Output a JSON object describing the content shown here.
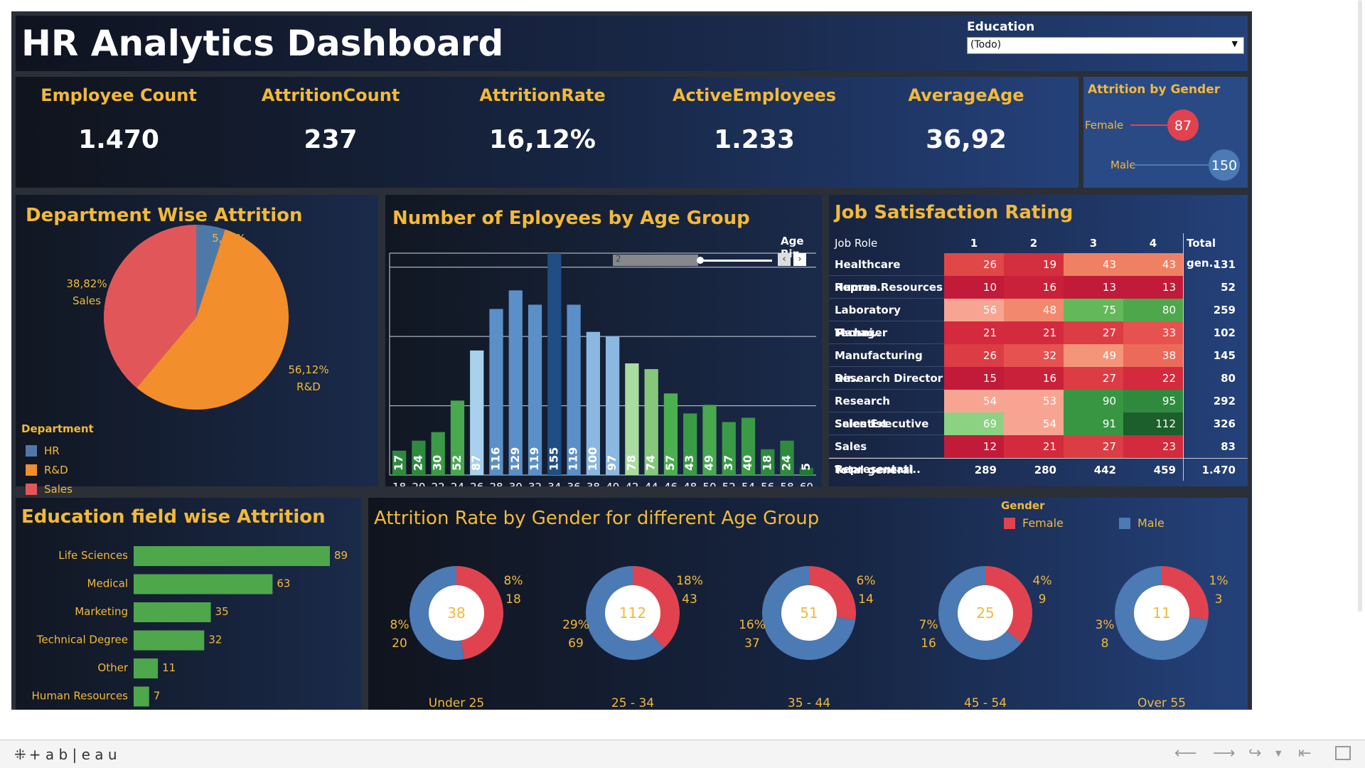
{
  "header": {
    "title": "HR Analytics Dashboard"
  },
  "filter": {
    "label": "Education",
    "value": "(Todo)"
  },
  "kpis": [
    {
      "label": "Employee Count",
      "value": "1.470"
    },
    {
      "label": "AttritionCount",
      "value": "237"
    },
    {
      "label": "AttritionRate",
      "value": "16,12%"
    },
    {
      "label": "ActiveEmployees",
      "value": "1.233"
    },
    {
      "label": "AverageAge",
      "value": "36,92"
    }
  ],
  "gender_attrition": {
    "title": "Attrition by Gender",
    "rows": [
      {
        "label": "Female",
        "value": 87,
        "color": "#e0434f"
      },
      {
        "label": "Male",
        "value": 150,
        "color": "#4b7ab5"
      }
    ]
  },
  "department": {
    "title": "Department Wise Attrition",
    "legend_title": "Department",
    "slices": [
      {
        "name": "HR",
        "pct": "5,06%",
        "value": 5.06,
        "color": "#4e79a7"
      },
      {
        "name": "R&D",
        "pct": "56,12%",
        "value": 56.12,
        "color": "#f28e2b"
      },
      {
        "name": "Sales",
        "pct": "38,82%",
        "value": 38.82,
        "color": "#e15759"
      }
    ]
  },
  "age_hist": {
    "title": "Number of Eployees by Age Group",
    "control_label": "Age Bin",
    "slider_value": "2",
    "bins": [
      18,
      20,
      22,
      24,
      26,
      28,
      30,
      32,
      34,
      36,
      38,
      40,
      42,
      44,
      46,
      48,
      50,
      52,
      54,
      56,
      58,
      60
    ],
    "values": [
      17,
      24,
      30,
      52,
      87,
      116,
      129,
      119,
      155,
      119,
      100,
      97,
      78,
      74,
      57,
      43,
      49,
      37,
      40,
      18,
      24,
      5
    ],
    "colors": [
      "#2e8b3e",
      "#2e8b3e",
      "#3a9a45",
      "#48a94f",
      "#a9d0ec",
      "#5b8fc7",
      "#5b8fc7",
      "#5b8fc7",
      "#1f4e85",
      "#5b8fc7",
      "#8ab8e0",
      "#8ab8e0",
      "#a9dca0",
      "#86c77c",
      "#4caf50",
      "#3a9a45",
      "#48a94f",
      "#3a9a45",
      "#3a9a45",
      "#2e8b3e",
      "#2e8b3e",
      "#1f7a34"
    ]
  },
  "chart_data": [
    {
      "type": "pie",
      "title": "Department Wise Attrition",
      "categories": [
        "HR",
        "R&D",
        "Sales"
      ],
      "values": [
        5.06,
        56.12,
        38.82
      ]
    },
    {
      "type": "bar",
      "title": "Number of Eployees by Age Group",
      "xlabel": "Age Bin",
      "categories": [
        18,
        20,
        22,
        24,
        26,
        28,
        30,
        32,
        34,
        36,
        38,
        40,
        42,
        44,
        46,
        48,
        50,
        52,
        54,
        56,
        58,
        60
      ],
      "values": [
        17,
        24,
        30,
        52,
        87,
        116,
        129,
        119,
        155,
        119,
        100,
        97,
        78,
        74,
        57,
        43,
        49,
        37,
        40,
        18,
        24,
        5
      ]
    },
    {
      "type": "bar",
      "title": "Education field wise Attrition",
      "categories": [
        "Life Sciences",
        "Medical",
        "Marketing",
        "Technical Degree",
        "Other",
        "Human Resources"
      ],
      "values": [
        89,
        63,
        35,
        32,
        11,
        7
      ]
    },
    {
      "type": "pie",
      "title": "Attrition Rate by Gender for different Age Group",
      "groups": [
        "Under 25",
        "25 - 34",
        "35 - 44",
        "45 - 54",
        "Over 55"
      ],
      "female": [
        18,
        43,
        14,
        9,
        3
      ],
      "male": [
        20,
        69,
        37,
        16,
        8
      ],
      "total": [
        38,
        112,
        51,
        25,
        11
      ]
    }
  ],
  "job_sat": {
    "title": "Job Satisfaction Rating",
    "headers": [
      "Job Role",
      "1",
      "2",
      "3",
      "4",
      "Total gen.."
    ],
    "rows": [
      {
        "role": "Healthcare Repres..",
        "vals": [
          26,
          19,
          43,
          43
        ],
        "total": "131",
        "colors": [
          "#e04848",
          "#d42f3e",
          "#f08063",
          "#f08063"
        ]
      },
      {
        "role": "Human Resources",
        "vals": [
          10,
          16,
          13,
          13
        ],
        "total": "52",
        "colors": [
          "#c21a39",
          "#c82139",
          "#c21a39",
          "#c21a39"
        ]
      },
      {
        "role": "Laboratory Techni..",
        "vals": [
          56,
          48,
          75,
          80
        ],
        "total": "259",
        "colors": [
          "#f7a592",
          "#f2896e",
          "#63b85a",
          "#4ea74b"
        ]
      },
      {
        "role": "Manager",
        "vals": [
          21,
          21,
          27,
          33
        ],
        "total": "102",
        "colors": [
          "#d32a3d",
          "#d32a3d",
          "#dc3c44",
          "#e6524f"
        ]
      },
      {
        "role": "Manufacturing Dir..",
        "vals": [
          26,
          32,
          49,
          38
        ],
        "total": "145",
        "colors": [
          "#dc3c44",
          "#e6524f",
          "#f4957a",
          "#ec6a5a"
        ]
      },
      {
        "role": "Research Director",
        "vals": [
          15,
          16,
          27,
          22
        ],
        "total": "80",
        "colors": [
          "#c21a39",
          "#c82139",
          "#dc3c44",
          "#d32a3d"
        ]
      },
      {
        "role": "Research Scientist",
        "vals": [
          54,
          53,
          90,
          95
        ],
        "total": "292",
        "colors": [
          "#f7a592",
          "#f7a592",
          "#389643",
          "#2f8a3d"
        ]
      },
      {
        "role": "Sales Executive",
        "vals": [
          69,
          54,
          91,
          112
        ],
        "total": "326",
        "colors": [
          "#8bd283",
          "#f7a592",
          "#389643",
          "#1c5e2c"
        ]
      },
      {
        "role": "Sales Representati..",
        "vals": [
          12,
          21,
          27,
          23
        ],
        "total": "83",
        "colors": [
          "#c21a39",
          "#d32a3d",
          "#dc3c44",
          "#d32a3d"
        ]
      }
    ],
    "totals": {
      "label": "Total general",
      "vals": [
        "289",
        "280",
        "442",
        "459"
      ],
      "total": "1.470"
    }
  },
  "education": {
    "title": "Education field wise Attrition",
    "items": [
      {
        "label": "Life Sciences",
        "value": 89
      },
      {
        "label": "Medical",
        "value": 63
      },
      {
        "label": "Marketing",
        "value": 35
      },
      {
        "label": "Technical Degree",
        "value": 32
      },
      {
        "label": "Other",
        "value": 11
      },
      {
        "label": "Human Resources",
        "value": 7
      }
    ],
    "bar_color": "#4ea74b"
  },
  "gender_age": {
    "title": "Attrition Rate by Gender for different Age Group",
    "legend_title": "Gender",
    "legend": [
      {
        "label": "Female",
        "color": "#e0434f"
      },
      {
        "label": "Male",
        "color": "#4b7ab5"
      }
    ],
    "groups": [
      {
        "label": "Under 25",
        "total": "38",
        "female": 18,
        "male": 20,
        "f_pct": "8%",
        "f_val": "18",
        "m_pct": "8%",
        "m_val": "20"
      },
      {
        "label": "25 - 34",
        "total": "112",
        "female": 43,
        "male": 69,
        "f_pct": "18%",
        "f_val": "43",
        "m_pct": "29%",
        "m_val": "69"
      },
      {
        "label": "35 - 44",
        "total": "51",
        "female": 14,
        "male": 37,
        "f_pct": "6%",
        "f_val": "14",
        "m_pct": "16%",
        "m_val": "37"
      },
      {
        "label": "45 - 54",
        "total": "25",
        "female": 9,
        "male": 16,
        "f_pct": "4%",
        "f_val": "9",
        "m_pct": "7%",
        "m_val": "16"
      },
      {
        "label": "Over 55",
        "total": "11",
        "female": 3,
        "male": 8,
        "f_pct": "1%",
        "f_val": "3",
        "m_pct": "3%",
        "m_val": "8"
      }
    ]
  },
  "footer": {
    "brand": "+ a b | e a u"
  }
}
